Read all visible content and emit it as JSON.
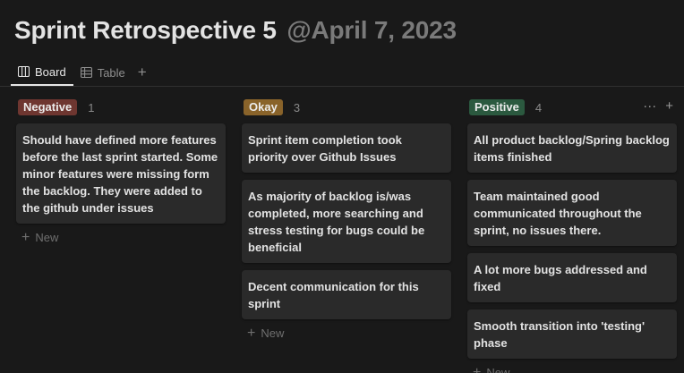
{
  "page": {
    "title": "Sprint Retrospective 5",
    "date_mention": "@April 7, 2023"
  },
  "tabs": [
    {
      "label": "Board",
      "icon": "board-icon",
      "active": true
    },
    {
      "label": "Table",
      "icon": "table-icon",
      "active": false
    }
  ],
  "add_view_label": "+",
  "columns": [
    {
      "label": "Negative",
      "count": "1",
      "color": "#6e3630",
      "cards": [
        "Should have defined more features before the last sprint started. Some minor features were missing form the backlog. They were added to the github under issues"
      ],
      "new_label": "New"
    },
    {
      "label": "Okay",
      "count": "3",
      "color": "#89632a",
      "cards": [
        "Sprint item completion took priority over Github Issues",
        "As majority of backlog is/was completed, more searching and stress testing for bugs could be beneficial",
        "Decent communication for this sprint"
      ],
      "new_label": "New"
    },
    {
      "label": "Positive",
      "count": "4",
      "color": "#2b593f",
      "cards": [
        "All product backlog/Spring backlog items finished",
        "Team maintained good communicated throughout the sprint, no issues there.",
        "A lot more bugs addressed and fixed",
        "Smooth transition into 'testing' phase"
      ],
      "new_label": "New"
    }
  ],
  "column_actions": {
    "more": "···",
    "add": "+"
  },
  "colors": {
    "background": "#191919",
    "card": "#2a2a2a",
    "text": "#e2e2e2",
    "muted": "#8e8e8e"
  }
}
